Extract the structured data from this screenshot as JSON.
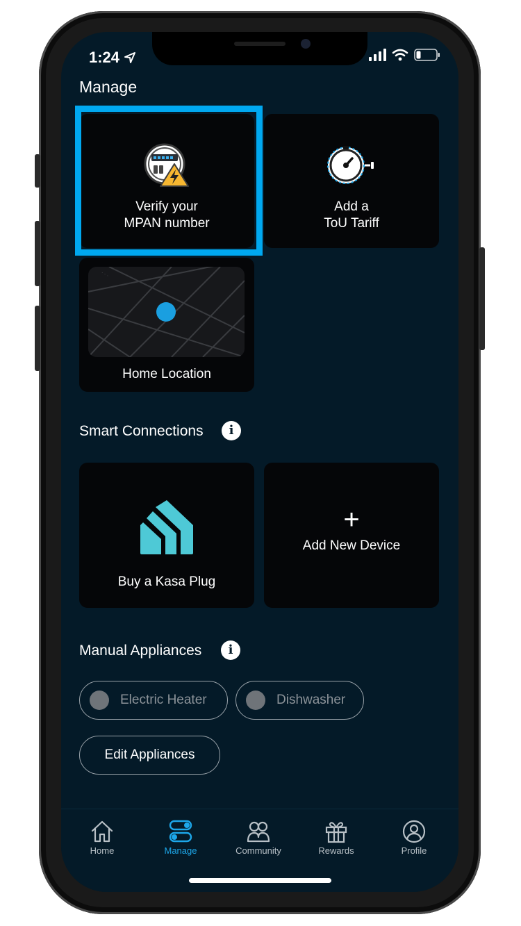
{
  "status_bar": {
    "time": "1:24"
  },
  "page": {
    "title": "Manage"
  },
  "cards": {
    "mpan": {
      "label": "Verify your\nMPAN number"
    },
    "tou": {
      "label": "Add a\nToU Tariff"
    },
    "home_location": {
      "label": "Home Location"
    }
  },
  "smart_connections": {
    "title": "Smart Connections",
    "kasa": {
      "label": "Buy a Kasa Plug"
    },
    "add_device": {
      "label": "Add New Device",
      "icon": "+"
    }
  },
  "manual_appliances": {
    "title": "Manual Appliances",
    "items": [
      {
        "label": "Electric Heater"
      },
      {
        "label": "Dishwasher"
      }
    ],
    "edit_label": "Edit Appliances"
  },
  "tabbar": {
    "items": [
      {
        "label": "Home",
        "icon": "house-icon"
      },
      {
        "label": "Manage",
        "icon": "toggles-icon"
      },
      {
        "label": "Community",
        "icon": "people-icon"
      },
      {
        "label": "Rewards",
        "icon": "gift-icon"
      },
      {
        "label": "Profile",
        "icon": "user-circle-icon"
      }
    ],
    "active": "Manage"
  },
  "colors": {
    "background": "#041a28",
    "card": "#050608",
    "highlight": "#00a8f0",
    "accent": "#1da7ea",
    "kasa": "#4ec9d6",
    "warning": "#f7b731"
  }
}
